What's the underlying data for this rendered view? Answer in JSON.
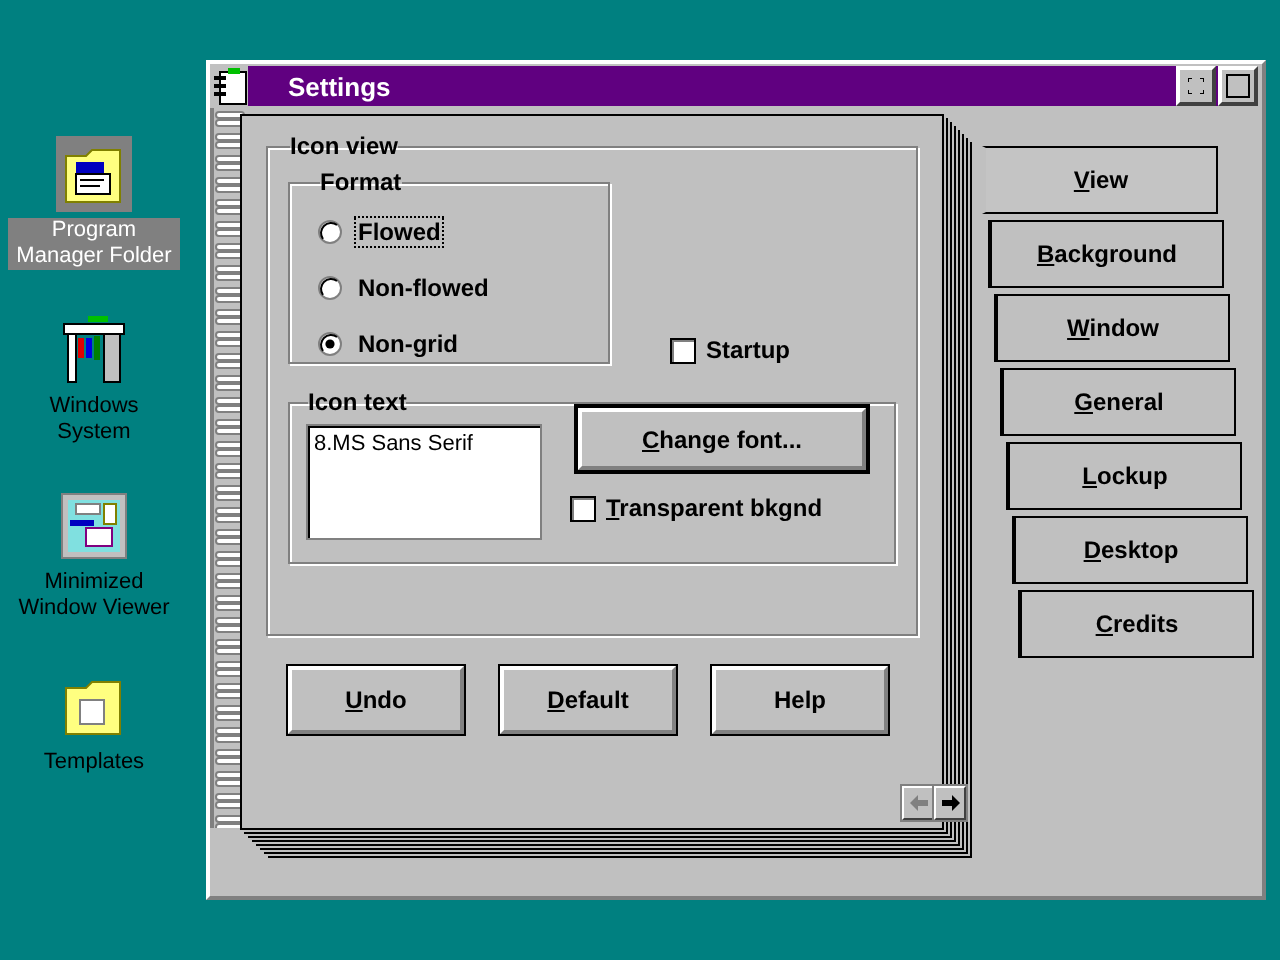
{
  "desktop_icons": [
    {
      "kind": "program-folder",
      "label": "Program Manager Folder",
      "selected": true
    },
    {
      "kind": "system",
      "label": "Windows System",
      "selected": false
    },
    {
      "kind": "viewer",
      "label": "Minimized Window Viewer",
      "selected": false
    },
    {
      "kind": "folder",
      "label": "Templates",
      "selected": false
    }
  ],
  "window": {
    "title": "Settings"
  },
  "icon_view": {
    "title": "Icon view",
    "format": {
      "title": "Format",
      "options": [
        {
          "label": "Flowed",
          "selected": false,
          "focused": true
        },
        {
          "label": "Non-flowed",
          "selected": false,
          "focused": false
        },
        {
          "label": "Non-grid",
          "selected": true,
          "focused": false
        }
      ]
    },
    "startup": {
      "label": "Startup",
      "checked": false
    },
    "icon_text": {
      "title": "Icon text",
      "font": "8.MS Sans Serif",
      "change_font": {
        "label": "Change font...",
        "mnemonic": true
      },
      "transparent": {
        "label": "Transparent bkgnd",
        "checked": false,
        "mnemonic": true
      }
    }
  },
  "buttons": [
    {
      "label": "Undo",
      "mnemonic": true
    },
    {
      "label": "Default",
      "mnemonic": true
    },
    {
      "label": "Help",
      "mnemonic": false
    }
  ],
  "page_arrows": [
    {
      "kind": "left",
      "disabled": true
    },
    {
      "kind": "right",
      "disabled": false
    }
  ],
  "tabs": [
    {
      "label": "View",
      "selected": true
    },
    {
      "label": "Background",
      "selected": false
    },
    {
      "label": "Window",
      "selected": false
    },
    {
      "label": "General",
      "selected": false
    },
    {
      "label": "Lockup",
      "selected": false
    },
    {
      "label": "Desktop",
      "selected": false
    },
    {
      "label": "Credits",
      "selected": false
    }
  ]
}
